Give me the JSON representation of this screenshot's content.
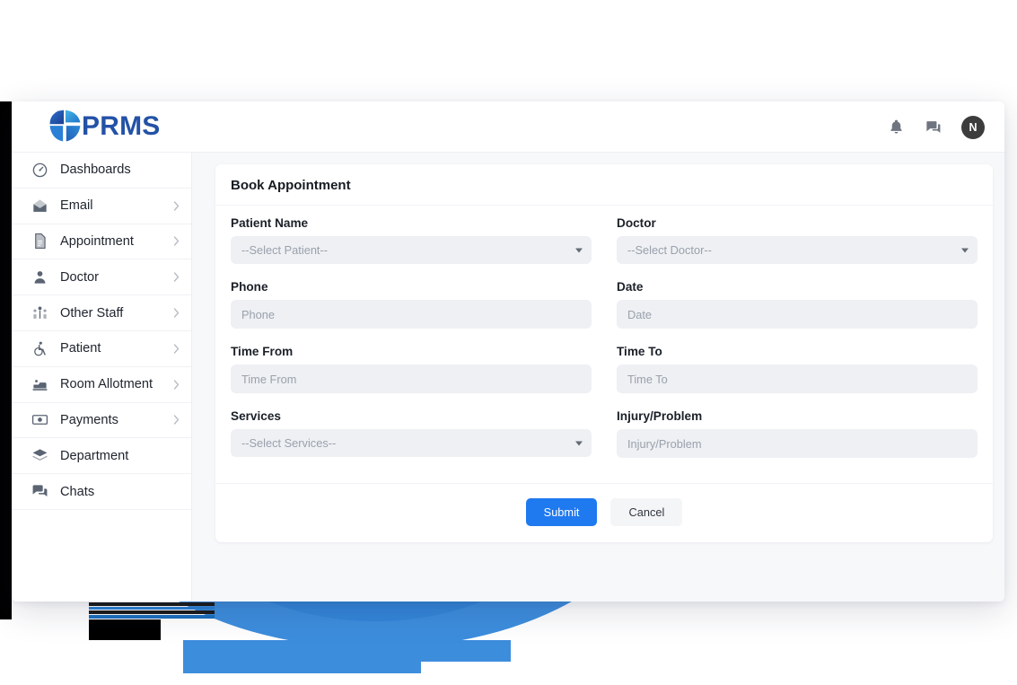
{
  "window": {
    "brand_name": "PRMS",
    "brand_color": "#2352a6"
  },
  "topbar": {
    "notifications_icon": "bell-icon",
    "messages_icon": "chat-icon",
    "avatar_initial": "N"
  },
  "sidebar": {
    "items": [
      {
        "label": "Dashboards",
        "icon": "gauge-icon",
        "has_chevron": false
      },
      {
        "label": "Email",
        "icon": "envelope-icon",
        "has_chevron": true
      },
      {
        "label": "Appointment",
        "icon": "document-icon",
        "has_chevron": true
      },
      {
        "label": "Doctor",
        "icon": "user-icon",
        "has_chevron": true
      },
      {
        "label": "Other Staff",
        "icon": "people-icon",
        "has_chevron": true
      },
      {
        "label": "Patient",
        "icon": "wheelchair-icon",
        "has_chevron": true
      },
      {
        "label": "Room Allotment",
        "icon": "bed-icon",
        "has_chevron": true
      },
      {
        "label": "Payments",
        "icon": "money-icon",
        "has_chevron": true
      },
      {
        "label": "Department",
        "icon": "layers-icon",
        "has_chevron": false
      },
      {
        "label": "Chats",
        "icon": "chat-bubble-icon",
        "has_chevron": false
      }
    ]
  },
  "main": {
    "card_title": "Book Appointment",
    "fields": {
      "patient_name": {
        "label": "Patient Name",
        "value": "--Select Patient--",
        "type": "select"
      },
      "doctor": {
        "label": "Doctor",
        "value": "--Select Doctor--",
        "type": "select"
      },
      "phone": {
        "label": "Phone",
        "placeholder": "Phone",
        "value": "",
        "type": "text"
      },
      "date": {
        "label": "Date",
        "placeholder": "Date",
        "value": "",
        "type": "text"
      },
      "time_from": {
        "label": "Time From",
        "placeholder": "Time From",
        "value": "",
        "type": "text"
      },
      "time_to": {
        "label": "Time To",
        "placeholder": "Time To",
        "value": "",
        "type": "text"
      },
      "services": {
        "label": "Services",
        "value": "--Select Services--",
        "type": "select"
      },
      "injury": {
        "label": "Injury/Problem",
        "placeholder": "Injury/Problem",
        "value": "",
        "type": "text"
      }
    },
    "submit_label": "Submit",
    "cancel_label": "Cancel",
    "submit_color": "#1f79ef"
  },
  "background": {
    "arc_back_color": "#2c7fd4",
    "arc_front_color": "#3d8ddd",
    "block_color": "#000000"
  }
}
